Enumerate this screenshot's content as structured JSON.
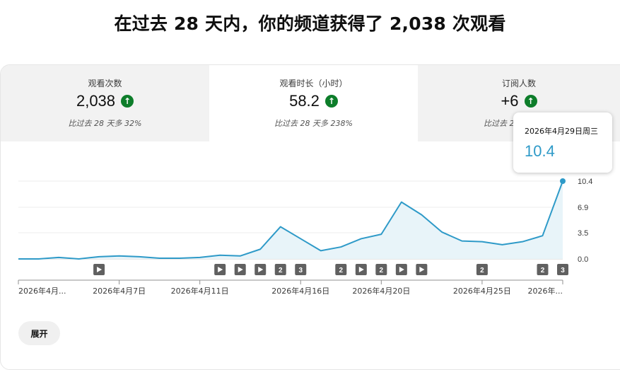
{
  "headline": "在过去 28 天内，你的频道获得了 2,038 次观看",
  "metrics": [
    {
      "label": "观看次数",
      "value": "2,038",
      "comparison": "比过去 28 天多 32%",
      "trend": "up-arrow-icon"
    },
    {
      "label": "观看时长（小时）",
      "value": "58.2",
      "comparison": "比过去 28 天多 238%",
      "trend": "up-arrow-icon"
    },
    {
      "label": "订阅人数",
      "value": "+6",
      "comparison": "比过去 2",
      "trend": "up-arrow-icon"
    }
  ],
  "tooltip": {
    "date": "2026年4月29日周三",
    "value": "10.4"
  },
  "expand_label": "展开",
  "colors": {
    "line": "#2e9ac8",
    "fill": "#e8f4f9",
    "up": "#0d7d2a"
  },
  "chart_data": {
    "type": "area",
    "x": [
      "2026年4月2日",
      "2026年4月3日",
      "2026年4月4日",
      "2026年4月5日",
      "2026年4月6日",
      "2026年4月7日",
      "2026年4月8日",
      "2026年4月9日",
      "2026年4月10日",
      "2026年4月11日",
      "2026年4月12日",
      "2026年4月13日",
      "2026年4月14日",
      "2026年4月15日",
      "2026年4月16日",
      "2026年4月17日",
      "2026年4月18日",
      "2026年4月19日",
      "2026年4月20日",
      "2026年4月21日",
      "2026年4月22日",
      "2026年4月23日",
      "2026年4月24日",
      "2026年4月25日",
      "2026年4月26日",
      "2026年4月27日",
      "2026年4月28日",
      "2026年4月29日"
    ],
    "series": [
      {
        "values": [
          0.0,
          0.0,
          0.2,
          0.0,
          0.3,
          0.4,
          0.3,
          0.1,
          0.1,
          0.2,
          0.5,
          0.4,
          1.3,
          4.3,
          2.7,
          1.1,
          1.6,
          2.7,
          3.3,
          7.6,
          5.9,
          3.6,
          2.4,
          2.3,
          1.9,
          2.3,
          3.1,
          10.4
        ]
      }
    ],
    "yticks": [
      "0.0",
      "3.5",
      "6.9",
      "10.4"
    ],
    "ylim": [
      0,
      10.4
    ],
    "xtick_labels": [
      {
        "index": 0,
        "label": "2026年4月..."
      },
      {
        "index": 5,
        "label": "2026年4月7日"
      },
      {
        "index": 9,
        "label": "2026年4月11日"
      },
      {
        "index": 14,
        "label": "2026年4月16日"
      },
      {
        "index": 18,
        "label": "2026年4月20日"
      },
      {
        "index": 23,
        "label": "2026年4月25日"
      },
      {
        "index": 27,
        "label": "2026年..."
      }
    ],
    "markers": [
      {
        "index": 4,
        "type": "play-icon"
      },
      {
        "index": 10,
        "type": "play-icon"
      },
      {
        "index": 11,
        "type": "play-icon"
      },
      {
        "index": 12,
        "type": "play-icon"
      },
      {
        "index": 13,
        "type": "count",
        "label": "2"
      },
      {
        "index": 14,
        "type": "count",
        "label": "3"
      },
      {
        "index": 16,
        "type": "count",
        "label": "2"
      },
      {
        "index": 17,
        "type": "play-icon"
      },
      {
        "index": 18,
        "type": "count",
        "label": "2"
      },
      {
        "index": 19,
        "type": "play-icon"
      },
      {
        "index": 20,
        "type": "play-icon"
      },
      {
        "index": 23,
        "type": "count",
        "label": "2"
      },
      {
        "index": 26,
        "type": "count",
        "label": "2"
      },
      {
        "index": 27,
        "type": "count",
        "label": "3"
      }
    ],
    "grid": true
  }
}
